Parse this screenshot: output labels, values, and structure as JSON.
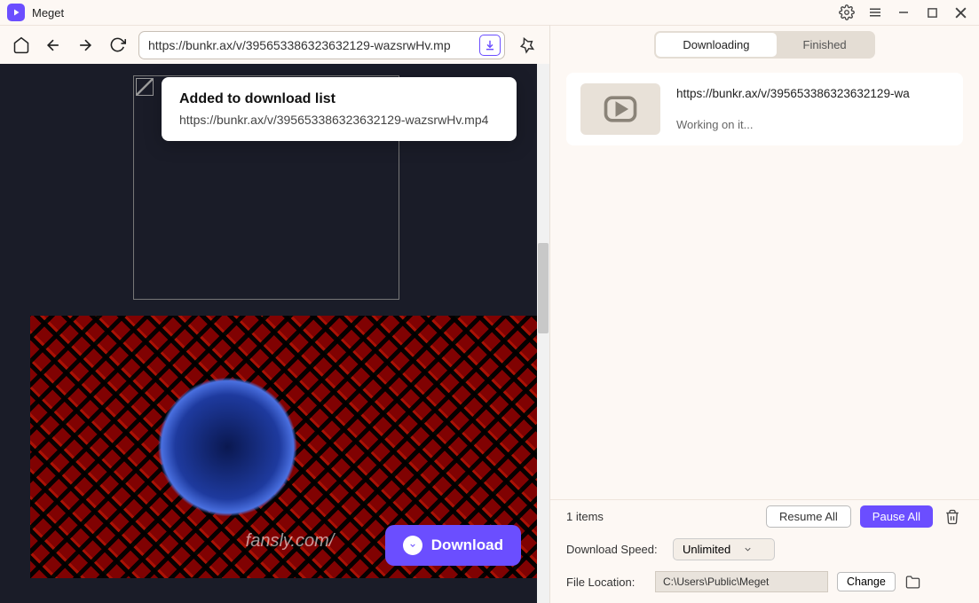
{
  "app": {
    "title": "Meget"
  },
  "toolbar": {
    "url": "https://bunkr.ax/v/395653386323632129-wazsrwHv.mp"
  },
  "notification": {
    "title": "Added to download list",
    "url": "https://bunkr.ax/v/395653386323632129-wazsrwHv.mp4"
  },
  "preview": {
    "watermark": "fansly.com/",
    "download_label": "Download"
  },
  "tabs": {
    "downloading": "Downloading",
    "finished": "Finished"
  },
  "download_item": {
    "url": "https://bunkr.ax/v/395653386323632129-wa",
    "status": "Working on it..."
  },
  "footer": {
    "items_count": "1 items",
    "resume_label": "Resume All",
    "pause_label": "Pause All"
  },
  "settings": {
    "speed_label": "Download Speed:",
    "speed_value": "Unlimited",
    "location_label": "File Location:",
    "location_value": "C:\\Users\\Public\\Meget",
    "change_label": "Change"
  }
}
